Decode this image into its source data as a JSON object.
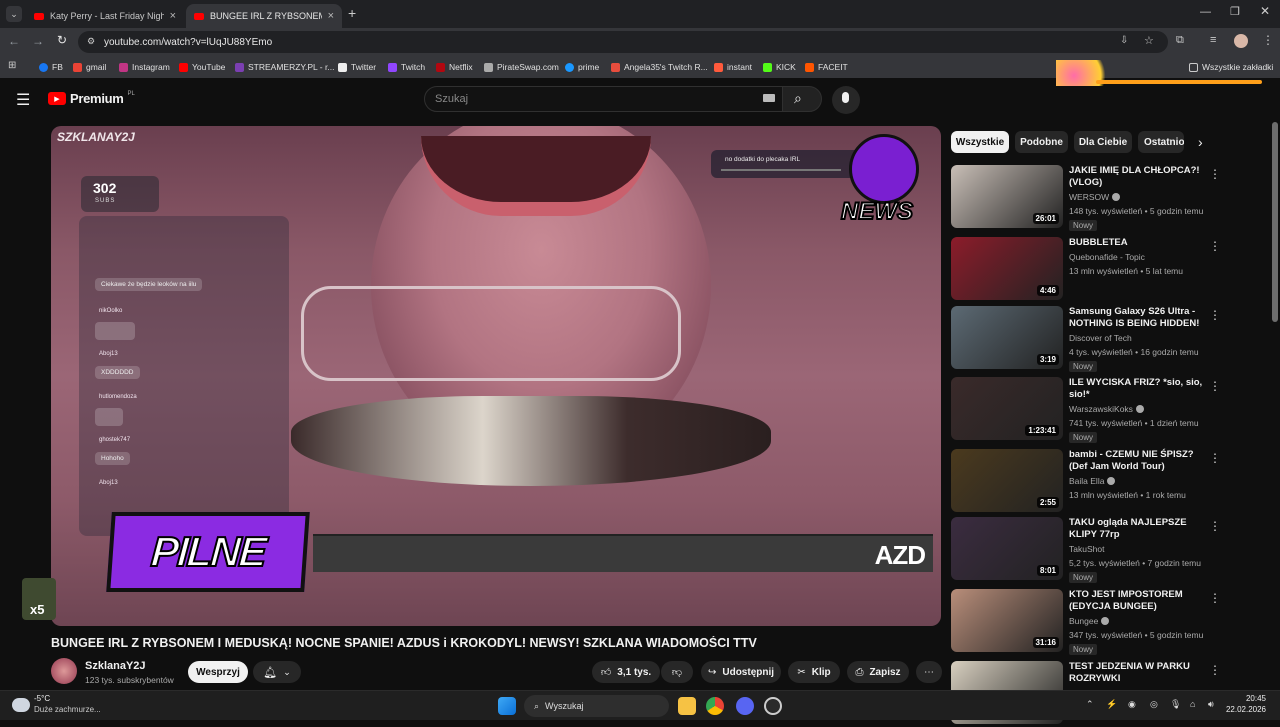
{
  "browser": {
    "tabs": [
      {
        "title": "Katy Perry - Last Friday Night (T",
        "active": false
      },
      {
        "title": "BUNGEE IRL Z RYBSONEM I MEDUSK",
        "active": true
      }
    ],
    "url": "youtube.com/watch?v=lUqJU88YEmo",
    "bookmarks": [
      "FB",
      "gmail",
      "Instagram",
      "YouTube",
      "STREAMERZY.PL - r...",
      "Twitter",
      "Twitch",
      "Netflix",
      "PirateSwap.com",
      "prime",
      "Angela35's Twitch R...",
      "instant",
      "KICK",
      "FACEIT"
    ],
    "all_bookmarks": "Wszystkie zakładki"
  },
  "header": {
    "logo": "Premium",
    "region": "PL",
    "search_placeholder": "Szukaj"
  },
  "video": {
    "overlay_channel": "SZKLANAY2J",
    "overlay_subs_count": "302",
    "overlay_subs_label": "SUBS",
    "chat": [
      {
        "user": "",
        "msg": "Ciekawe że będzie leoków na iilu"
      },
      {
        "user": "nikOolko",
        "msg": ""
      },
      {
        "user": "Aboj13",
        "msg": "XDDDDDD"
      },
      {
        "user": "hutlomendoza",
        "msg": ""
      },
      {
        "user": "ghostek747",
        "msg": "Hohoho"
      },
      {
        "user": "Aboj13",
        "msg": ""
      }
    ],
    "news_banner": "no dodatki do plecaka IRL",
    "news_logo": "NEWS",
    "pilne": "PILNE",
    "ticker": "AZD",
    "badge": "x5",
    "title": "BUNGEE IRL Z RYBSONEM I MEDUSKĄ! NOCNE SPANIE! AZDUS i KROKODYL! NEWSY! SZKLANA WIADOMOŚCI TTV"
  },
  "channel": {
    "name": "SzklanaY2J",
    "subscribers": "123 tys. subskrybentów",
    "support_label": "Wesprzyj"
  },
  "actions": {
    "likes": "3,1 tys.",
    "share": "Udostępnij",
    "clip": "Klip",
    "save": "Zapisz"
  },
  "chips": [
    "Wszystkie",
    "Podobne",
    "Dla Ciebie",
    "Ostatnio"
  ],
  "recommendations": [
    {
      "title": "JAKIE IMIĘ DLA CHŁOPCA?! (VLOG)",
      "channel": "WERSOW",
      "verified": true,
      "meta": "148 tys. wyświetleń • 5 godzin temu",
      "duration": "26:01",
      "badge": "Nowy",
      "color": "#c9bfb7"
    },
    {
      "title": "BUBBLETEA",
      "channel": "Quebonafide - Topic",
      "verified": false,
      "meta": "13 mln wyświetleń • 5 lat temu",
      "duration": "4:46",
      "badge": "",
      "color": "#8c1c2a"
    },
    {
      "title": "Samsung Galaxy S26 Ultra - NOTHING IS BEING HIDDEN!",
      "channel": "Discover of Tech",
      "verified": false,
      "meta": "4 tys. wyświetleń • 16 godzin temu",
      "duration": "3:19",
      "badge": "Nowy",
      "color": "#5c6a74"
    },
    {
      "title": "ILE WYCISKA FRIZ? *sio, sio, sio!*",
      "channel": "WarszawskiKoks",
      "verified": true,
      "meta": "741 tys. wyświetleń • 1 dzień temu",
      "duration": "1:23:41",
      "badge": "Nowy",
      "color": "#3a2a2a"
    },
    {
      "title": "bambi - CZEMU NIE ŚPISZ? (Def Jam World Tour)",
      "channel": "Baila Ella",
      "verified": true,
      "meta": "13 mln wyświetleń • 1 rok temu",
      "duration": "2:55",
      "badge": "",
      "color": "#4b3a1e"
    },
    {
      "title": "TAKU ogląda NAJLEPSZE KLIPY 77rp",
      "channel": "TakuShot",
      "verified": false,
      "meta": "5,2 tys. wyświetleń • 7 godzin temu",
      "duration": "8:01",
      "badge": "Nowy",
      "color": "#3b2c40"
    },
    {
      "title": "KTO JEST IMPOSTOREM (EDYCJA BUNGEE)",
      "channel": "Bungee",
      "verified": true,
      "meta": "347 tys. wyświetleń • 5 godzin temu",
      "duration": "31:16",
      "badge": "Nowy",
      "color": "#b98e7a"
    },
    {
      "title": "TEST JEDZENIA W PARKU ROZRYWKI",
      "channel": "",
      "verified": false,
      "meta": "",
      "duration": "",
      "badge": "",
      "color": "#d8d0c0"
    }
  ],
  "taskbar": {
    "weather_temp": "-5°C",
    "weather_desc": "Duże zachmurze...",
    "search": "Wyszukaj",
    "time": "20:45",
    "date": "22.02.2026"
  },
  "colors": {
    "accent": "#ff0000",
    "purple": "#8b2be2",
    "bg": "#0f0f0f"
  }
}
